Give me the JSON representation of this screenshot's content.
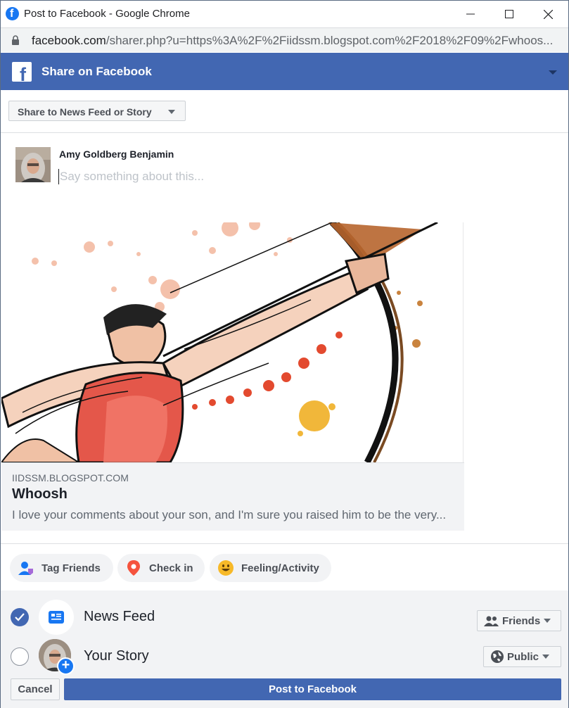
{
  "window": {
    "title": "Post to Facebook - Google Chrome",
    "url_host": "facebook.com",
    "url_path": "/sharer.php?u=https%3A%2F%2Fiidssm.blogspot.com%2F2018%2F09%2Fwhoos..."
  },
  "header": {
    "title": "Share on Facebook"
  },
  "share_target": {
    "selected": "Share to News Feed or Story"
  },
  "composer": {
    "user_name": "Amy Goldberg Benjamin",
    "value": "",
    "placeholder": "Say something about this..."
  },
  "link_preview": {
    "domain": "IIDSSM.BLOGSPOT.COM",
    "title": "Whoosh",
    "description": "I love your comments about your son, and I'm sure you raised him to be the very..."
  },
  "actions": [
    {
      "label": "Tag Friends",
      "icon": "tag-friends-icon"
    },
    {
      "label": "Check in",
      "icon": "location-pin-icon"
    },
    {
      "label": "Feeling/Activity",
      "icon": "smiley-icon"
    }
  ],
  "audience": {
    "news_feed": {
      "label": "News Feed",
      "checked": true,
      "privacy": "Friends"
    },
    "story": {
      "label": "Your Story",
      "checked": false,
      "privacy": "Public"
    }
  },
  "buttons": {
    "cancel": "Cancel",
    "post": "Post to Facebook"
  },
  "colors": {
    "brand": "#4267b2",
    "chrome_fb_icon": "#1877f2",
    "panel_bg": "#f2f3f5"
  }
}
